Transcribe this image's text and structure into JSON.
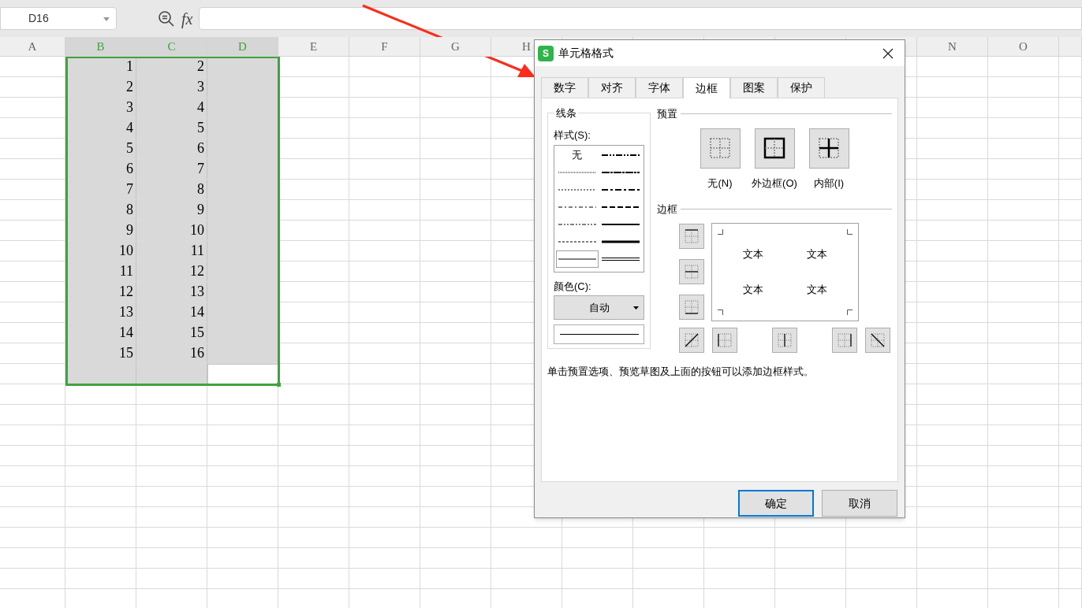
{
  "formula_bar": {
    "name_box": "D16",
    "formula_label": "fx"
  },
  "columns": [
    {
      "label": "A",
      "selected": false
    },
    {
      "label": "B",
      "selected": true
    },
    {
      "label": "C",
      "selected": true
    },
    {
      "label": "D",
      "selected": true
    },
    {
      "label": "E",
      "selected": false
    },
    {
      "label": "F",
      "selected": false
    },
    {
      "label": "G",
      "selected": false
    },
    {
      "label": "H",
      "selected": false
    }
  ],
  "columns_right": [
    {
      "label": "N",
      "selected": false
    },
    {
      "label": "O",
      "selected": false
    }
  ],
  "rows": [
    {
      "cells": [
        "1",
        "2"
      ],
      "selected": true,
      "active": false
    },
    {
      "cells": [
        "2",
        "3"
      ],
      "selected": true,
      "active": false
    },
    {
      "cells": [
        "3",
        "4"
      ],
      "selected": true,
      "active": false
    },
    {
      "cells": [
        "4",
        "5"
      ],
      "selected": true,
      "active": false
    },
    {
      "cells": [
        "5",
        "6"
      ],
      "selected": true,
      "active": false
    },
    {
      "cells": [
        "6",
        "7"
      ],
      "selected": true,
      "active": false
    },
    {
      "cells": [
        "7",
        "8"
      ],
      "selected": true,
      "active": false
    },
    {
      "cells": [
        "8",
        "9"
      ],
      "selected": true,
      "active": false
    },
    {
      "cells": [
        "9",
        "10"
      ],
      "selected": true,
      "active": false
    },
    {
      "cells": [
        "10",
        "11"
      ],
      "selected": true,
      "active": false
    },
    {
      "cells": [
        "11",
        "12"
      ],
      "selected": true,
      "active": false
    },
    {
      "cells": [
        "12",
        "13"
      ],
      "selected": true,
      "active": false
    },
    {
      "cells": [
        "13",
        "14"
      ],
      "selected": true,
      "active": false
    },
    {
      "cells": [
        "14",
        "15"
      ],
      "selected": true,
      "active": false
    },
    {
      "cells": [
        "15",
        "16"
      ],
      "selected": true,
      "active": false
    },
    {
      "cells": [],
      "selected": true,
      "active": true
    }
  ],
  "dialog": {
    "title": "单元格格式",
    "logo_text": "S",
    "tabs": [
      {
        "label": "数字",
        "selected": false
      },
      {
        "label": "对齐",
        "selected": false
      },
      {
        "label": "字体",
        "selected": false
      },
      {
        "label": "边框",
        "selected": true
      },
      {
        "label": "图案",
        "selected": false
      },
      {
        "label": "保护",
        "selected": false
      }
    ],
    "line_group": {
      "title": "线条",
      "style_label": "样式(S):",
      "styles": [
        {
          "kind": "none",
          "label": "无",
          "selected": false
        },
        {
          "kind": "medium-dash-dot-dot",
          "selected": false
        },
        {
          "kind": "hair",
          "selected": false
        },
        {
          "kind": "slant-dash-dot",
          "selected": false
        },
        {
          "kind": "dotted",
          "selected": false
        },
        {
          "kind": "medium-dash-dot",
          "selected": false
        },
        {
          "kind": "dash-dot",
          "selected": false
        },
        {
          "kind": "medium-dashed",
          "selected": false
        },
        {
          "kind": "dash-dot-dot",
          "selected": false
        },
        {
          "kind": "medium",
          "selected": false
        },
        {
          "kind": "dashed",
          "selected": false
        },
        {
          "kind": "thick",
          "selected": false
        },
        {
          "kind": "thin",
          "selected": true
        },
        {
          "kind": "double",
          "selected": false
        }
      ],
      "color_label": "颜色(C):",
      "color_value": "自动"
    },
    "presets": {
      "title": "预置",
      "items": [
        {
          "kind": "none",
          "label": "无(N)"
        },
        {
          "kind": "outline",
          "label": "外边框(O)"
        },
        {
          "kind": "inside",
          "label": "内部(I)"
        }
      ]
    },
    "border": {
      "title": "边框",
      "side_buttons": [
        {
          "kind": "top"
        },
        {
          "kind": "middle-h"
        },
        {
          "kind": "bottom"
        }
      ],
      "bottom_buttons": [
        {
          "kind": "diag-up"
        },
        {
          "kind": "left"
        },
        {
          "kind": "middle-v"
        },
        {
          "kind": "right"
        },
        {
          "kind": "diag-down"
        }
      ],
      "preview_texts": [
        "文本",
        "文本",
        "文本",
        "文本"
      ]
    },
    "hint": "单击预置选项、预览草图及上面的按钮可以添加边框样式。",
    "buttons": [
      {
        "label": "确定",
        "default": true
      },
      {
        "label": "取消",
        "default": false
      }
    ]
  }
}
